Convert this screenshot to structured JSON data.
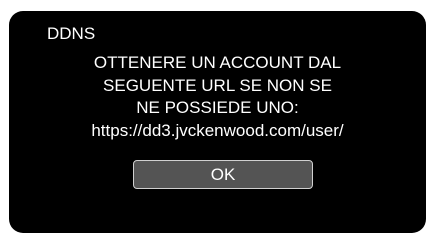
{
  "dialog": {
    "title": "DDNS",
    "message_lines": [
      "OTTENERE UN ACCOUNT DAL",
      "SEGUENTE URL SE NON SE",
      "NE POSSIEDE UNO:",
      "https://dd3.jvckenwood.com/user/"
    ],
    "ok_label": "OK"
  },
  "colors": {
    "panel_background": "#000000",
    "text": "#ffffff",
    "button_background": "#545454",
    "button_border": "#d0d0d0"
  }
}
